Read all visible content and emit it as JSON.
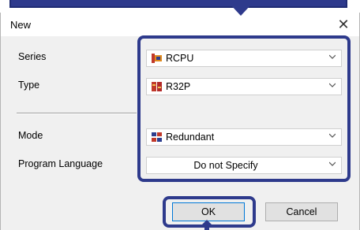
{
  "dialog": {
    "title": "New",
    "close_glyph": "✕"
  },
  "fields": {
    "series": {
      "label": "Series",
      "value": "RCPU",
      "icon": "rcpu-module-icon"
    },
    "type": {
      "label": "Type",
      "value": "R32P",
      "icon": "cpu-model-icon"
    },
    "mode": {
      "label": "Mode",
      "value": "Redundant",
      "icon": "redundant-mode-icon"
    },
    "language": {
      "label": "Program Language",
      "value": "Do not Specify"
    }
  },
  "buttons": {
    "ok": "OK",
    "cancel": "Cancel"
  },
  "colors": {
    "highlight": "#2e3a8c",
    "dialog_bg": "#f0f0f0"
  }
}
